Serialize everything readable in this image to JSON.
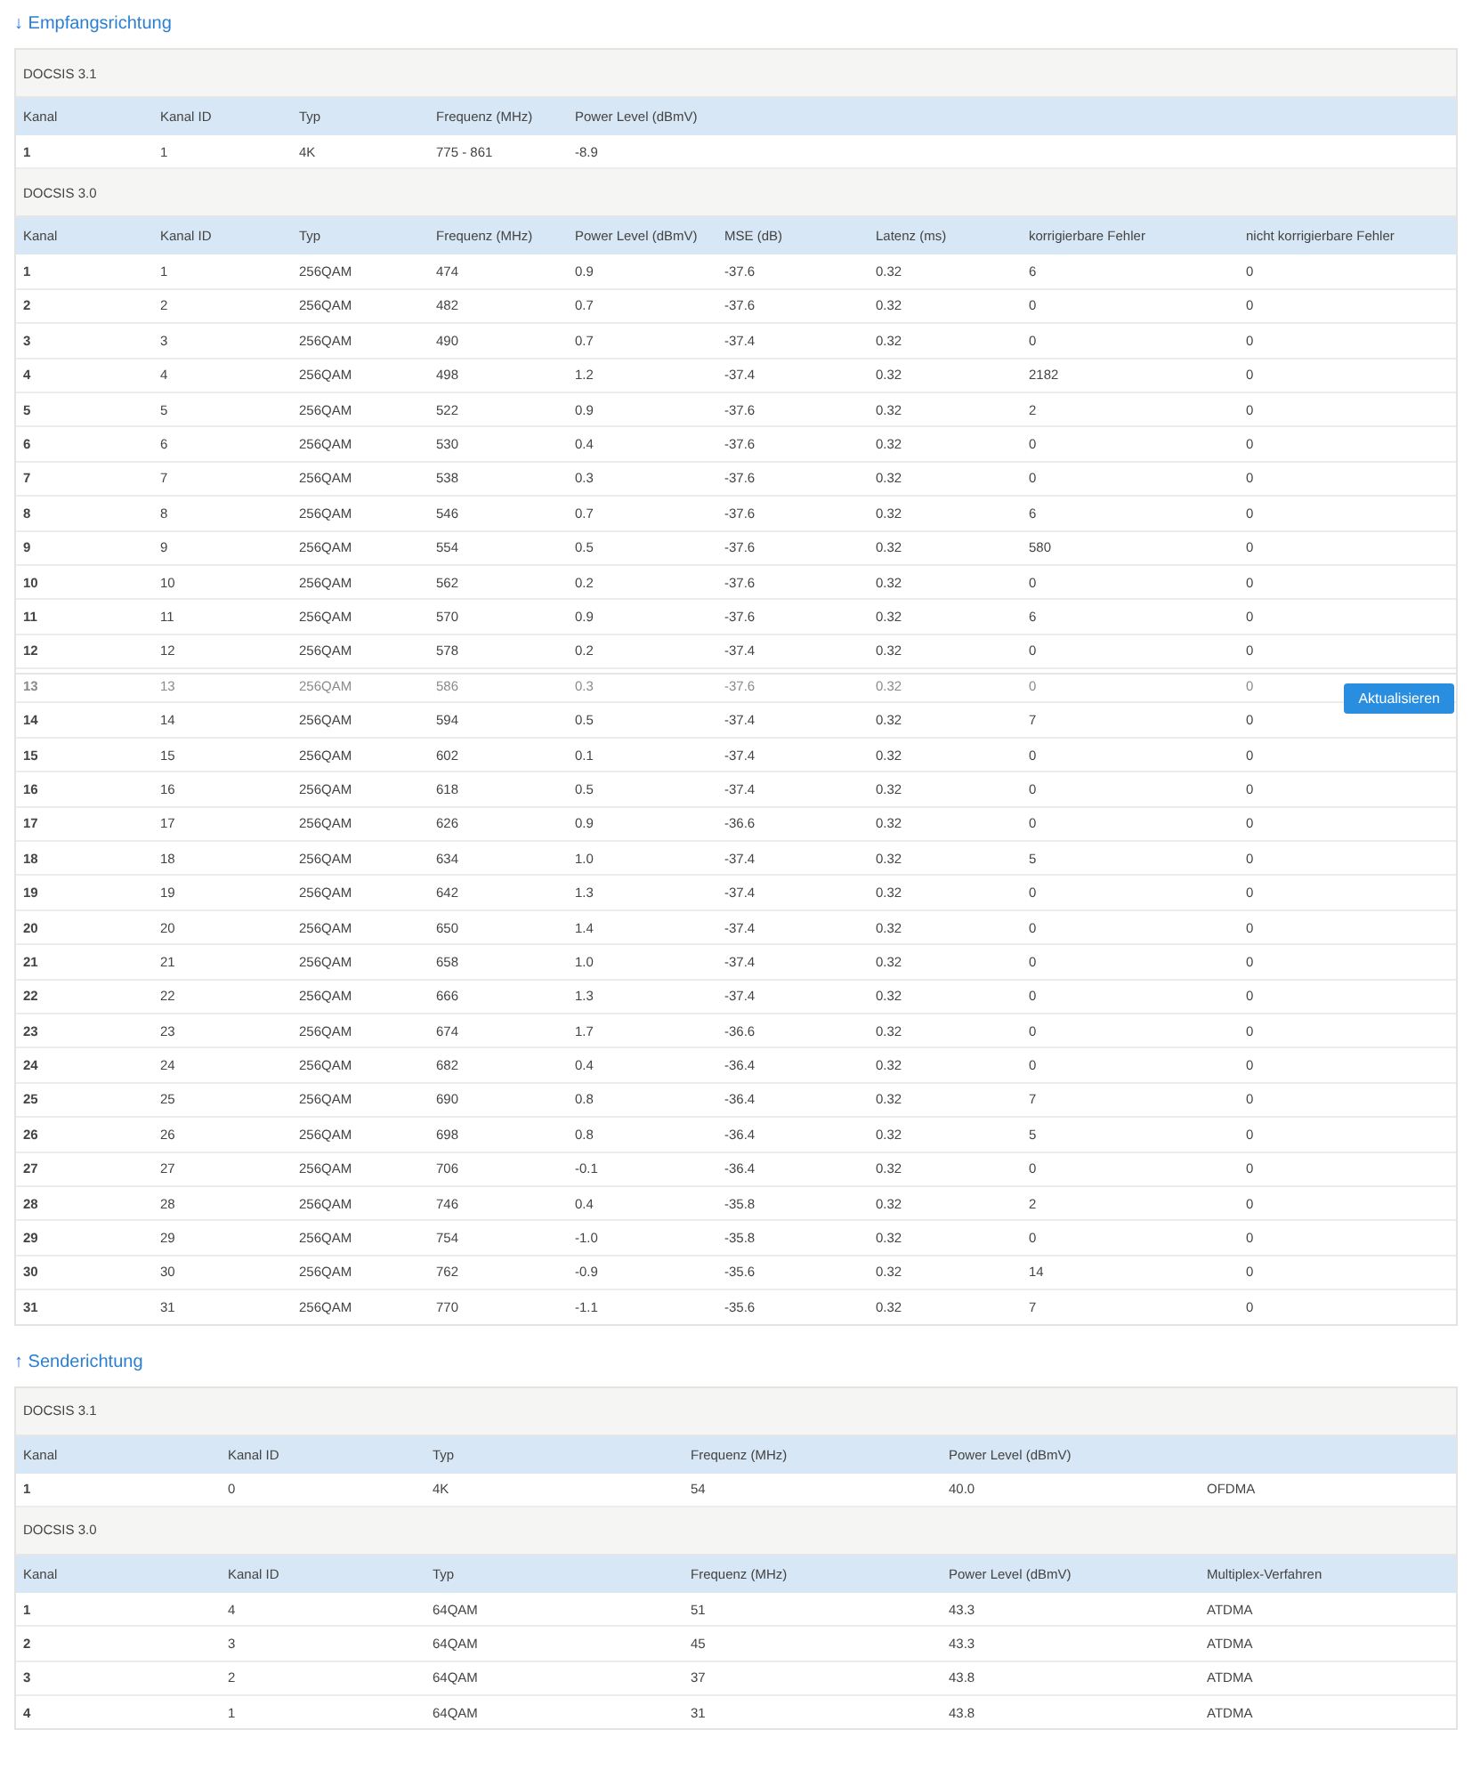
{
  "sections": [
    {
      "title": "↓ Empfangsrichtung",
      "groups": [
        {
          "label": "DOCSIS 3.1",
          "columns": [
            "Kanal",
            "Kanal ID",
            "Typ",
            "Frequenz (MHz)",
            "Power Level (dBmV)"
          ],
          "rows": [
            {
              "faded": false,
              "cells": [
                "1",
                "1",
                "4K",
                "775 - 861",
                "-8.9"
              ]
            }
          ]
        },
        {
          "label": "DOCSIS 3.0",
          "columns": [
            "Kanal",
            "Kanal ID",
            "Typ",
            "Frequenz (MHz)",
            "Power Level (dBmV)",
            "MSE (dB)",
            "Latenz (ms)",
            "korrigierbare Fehler",
            "nicht korrigierbare Fehler"
          ],
          "rows": [
            {
              "faded": false,
              "cells": [
                "1",
                "1",
                "256QAM",
                "474",
                "0.9",
                "-37.6",
                "0.32",
                "6",
                "0"
              ]
            },
            {
              "faded": false,
              "cells": [
                "2",
                "2",
                "256QAM",
                "482",
                "0.7",
                "-37.6",
                "0.32",
                "0",
                "0"
              ]
            },
            {
              "faded": false,
              "cells": [
                "3",
                "3",
                "256QAM",
                "490",
                "0.7",
                "-37.4",
                "0.32",
                "0",
                "0"
              ]
            },
            {
              "faded": false,
              "cells": [
                "4",
                "4",
                "256QAM",
                "498",
                "1.2",
                "-37.4",
                "0.32",
                "2182",
                "0"
              ]
            },
            {
              "faded": false,
              "cells": [
                "5",
                "5",
                "256QAM",
                "522",
                "0.9",
                "-37.6",
                "0.32",
                "2",
                "0"
              ]
            },
            {
              "faded": false,
              "cells": [
                "6",
                "6",
                "256QAM",
                "530",
                "0.4",
                "-37.6",
                "0.32",
                "0",
                "0"
              ]
            },
            {
              "faded": false,
              "cells": [
                "7",
                "7",
                "256QAM",
                "538",
                "0.3",
                "-37.6",
                "0.32",
                "0",
                "0"
              ]
            },
            {
              "faded": false,
              "cells": [
                "8",
                "8",
                "256QAM",
                "546",
                "0.7",
                "-37.6",
                "0.32",
                "6",
                "0"
              ]
            },
            {
              "faded": false,
              "cells": [
                "9",
                "9",
                "256QAM",
                "554",
                "0.5",
                "-37.6",
                "0.32",
                "580",
                "0"
              ]
            },
            {
              "faded": false,
              "cells": [
                "10",
                "10",
                "256QAM",
                "562",
                "0.2",
                "-37.6",
                "0.32",
                "0",
                "0"
              ]
            },
            {
              "faded": false,
              "cells": [
                "11",
                "11",
                "256QAM",
                "570",
                "0.9",
                "-37.6",
                "0.32",
                "6",
                "0"
              ]
            },
            {
              "faded": false,
              "cells": [
                "12",
                "12",
                "256QAM",
                "578",
                "0.2",
                "-37.4",
                "0.32",
                "0",
                "0"
              ]
            },
            {
              "faded": true,
              "cells": [
                "13",
                "13",
                "256QAM",
                "586",
                "0.3",
                "-37.6",
                "0.32",
                "0",
                "0"
              ]
            },
            {
              "faded": false,
              "cells": [
                "14",
                "14",
                "256QAM",
                "594",
                "0.5",
                "-37.4",
                "0.32",
                "7",
                "0"
              ]
            },
            {
              "faded": false,
              "cells": [
                "15",
                "15",
                "256QAM",
                "602",
                "0.1",
                "-37.4",
                "0.32",
                "0",
                "0"
              ]
            },
            {
              "faded": false,
              "cells": [
                "16",
                "16",
                "256QAM",
                "618",
                "0.5",
                "-37.4",
                "0.32",
                "0",
                "0"
              ]
            },
            {
              "faded": false,
              "cells": [
                "17",
                "17",
                "256QAM",
                "626",
                "0.9",
                "-36.6",
                "0.32",
                "0",
                "0"
              ]
            },
            {
              "faded": false,
              "cells": [
                "18",
                "18",
                "256QAM",
                "634",
                "1.0",
                "-37.4",
                "0.32",
                "5",
                "0"
              ]
            },
            {
              "faded": false,
              "cells": [
                "19",
                "19",
                "256QAM",
                "642",
                "1.3",
                "-37.4",
                "0.32",
                "0",
                "0"
              ]
            },
            {
              "faded": false,
              "cells": [
                "20",
                "20",
                "256QAM",
                "650",
                "1.4",
                "-37.4",
                "0.32",
                "0",
                "0"
              ]
            },
            {
              "faded": false,
              "cells": [
                "21",
                "21",
                "256QAM",
                "658",
                "1.0",
                "-37.4",
                "0.32",
                "0",
                "0"
              ]
            },
            {
              "faded": false,
              "cells": [
                "22",
                "22",
                "256QAM",
                "666",
                "1.3",
                "-37.4",
                "0.32",
                "0",
                "0"
              ]
            },
            {
              "faded": false,
              "cells": [
                "23",
                "23",
                "256QAM",
                "674",
                "1.7",
                "-36.6",
                "0.32",
                "0",
                "0"
              ]
            },
            {
              "faded": false,
              "cells": [
                "24",
                "24",
                "256QAM",
                "682",
                "0.4",
                "-36.4",
                "0.32",
                "0",
                "0"
              ]
            },
            {
              "faded": false,
              "cells": [
                "25",
                "25",
                "256QAM",
                "690",
                "0.8",
                "-36.4",
                "0.32",
                "7",
                "0"
              ]
            },
            {
              "faded": false,
              "cells": [
                "26",
                "26",
                "256QAM",
                "698",
                "0.8",
                "-36.4",
                "0.32",
                "5",
                "0"
              ]
            },
            {
              "faded": false,
              "cells": [
                "27",
                "27",
                "256QAM",
                "706",
                "-0.1",
                "-36.4",
                "0.32",
                "0",
                "0"
              ]
            },
            {
              "faded": false,
              "cells": [
                "28",
                "28",
                "256QAM",
                "746",
                "0.4",
                "-35.8",
                "0.32",
                "2",
                "0"
              ]
            },
            {
              "faded": false,
              "cells": [
                "29",
                "29",
                "256QAM",
                "754",
                "-1.0",
                "-35.8",
                "0.32",
                "0",
                "0"
              ]
            },
            {
              "faded": false,
              "cells": [
                "30",
                "30",
                "256QAM",
                "762",
                "-0.9",
                "-35.6",
                "0.32",
                "14",
                "0"
              ]
            },
            {
              "faded": false,
              "cells": [
                "31",
                "31",
                "256QAM",
                "770",
                "-1.1",
                "-35.6",
                "0.32",
                "7",
                "0"
              ]
            }
          ]
        }
      ]
    },
    {
      "title": "↑ Senderichtung",
      "groups": [
        {
          "label": "DOCSIS 3.1",
          "columns": [
            "Kanal",
            "Kanal ID",
            "Typ",
            "Frequenz (MHz)",
            "Power Level (dBmV)"
          ],
          "rows": [
            {
              "faded": false,
              "cells": [
                "1",
                "0",
                "4K",
                "54",
                "40.0",
                "OFDMA"
              ]
            }
          ]
        },
        {
          "label": "DOCSIS 3.0",
          "columns": [
            "Kanal",
            "Kanal ID",
            "Typ",
            "Frequenz (MHz)",
            "Power Level (dBmV)",
            "Multiplex-Verfahren"
          ],
          "rows": [
            {
              "faded": false,
              "cells": [
                "1",
                "4",
                "64QAM",
                "51",
                "43.3",
                "ATDMA"
              ]
            },
            {
              "faded": false,
              "cells": [
                "2",
                "3",
                "64QAM",
                "45",
                "43.3",
                "ATDMA"
              ]
            },
            {
              "faded": false,
              "cells": [
                "3",
                "2",
                "64QAM",
                "37",
                "43.8",
                "ATDMA"
              ]
            },
            {
              "faded": false,
              "cells": [
                "4",
                "1",
                "64QAM",
                "31",
                "43.8",
                "ATDMA"
              ]
            }
          ]
        }
      ]
    }
  ],
  "refresh_button": "Aktualisieren"
}
